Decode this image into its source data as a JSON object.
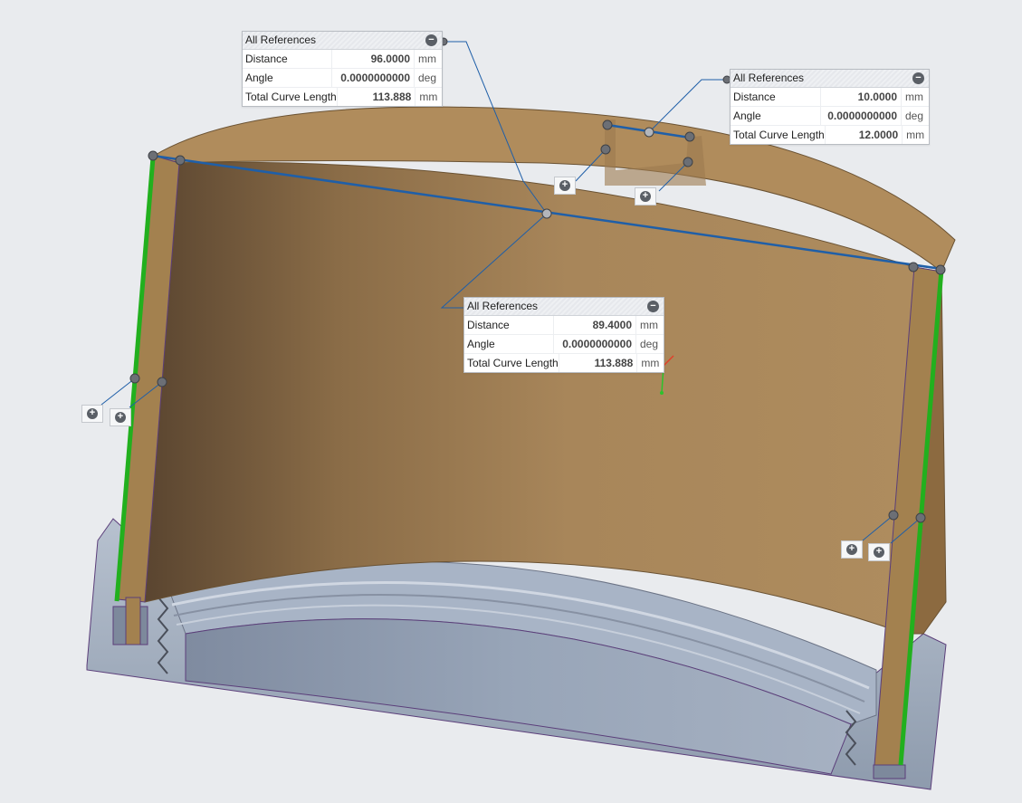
{
  "colors": {
    "background": "#e9ebee",
    "cylinder_face": "#a8865a",
    "cylinder_edge": "#8a6a42",
    "base_part": "#9aa6b6",
    "measure_line": "#1f5fa8",
    "selected_edge": "#22b01e"
  },
  "measurements": [
    {
      "title": "All References",
      "collapse_icon": "minus-circle-icon",
      "rows": [
        {
          "label": "Distance",
          "value": "96.0000",
          "unit": "mm"
        },
        {
          "label": "Angle",
          "value": "0.0000000000",
          "unit": "deg"
        },
        {
          "label": "Total Curve Length",
          "value": "113.888",
          "unit": "mm"
        }
      ]
    },
    {
      "title": "All References",
      "collapse_icon": "minus-circle-icon",
      "rows": [
        {
          "label": "Distance",
          "value": "10.0000",
          "unit": "mm"
        },
        {
          "label": "Angle",
          "value": "0.0000000000",
          "unit": "deg"
        },
        {
          "label": "Total Curve Length",
          "value": "12.0000",
          "unit": "mm"
        }
      ]
    },
    {
      "title": "All References",
      "collapse_icon": "minus-circle-icon",
      "rows": [
        {
          "label": "Distance",
          "value": "89.4000",
          "unit": "mm"
        },
        {
          "label": "Angle",
          "value": "0.0000000000",
          "unit": "deg"
        },
        {
          "label": "Total Curve Length",
          "value": "113.888",
          "unit": "mm"
        }
      ]
    }
  ],
  "add_reference_icon": "plus-circle-icon"
}
